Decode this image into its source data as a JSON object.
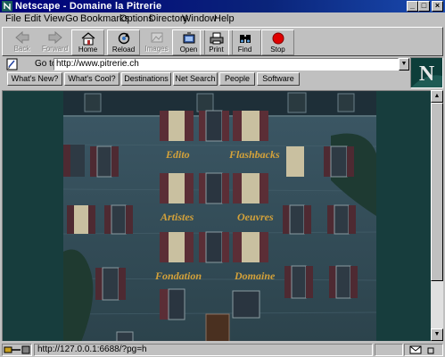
{
  "window": {
    "title": "Netscape - Domaine la Pitrerie"
  },
  "menu": [
    {
      "label": "File"
    },
    {
      "label": "Edit"
    },
    {
      "label": "View"
    },
    {
      "label": "Go"
    },
    {
      "label": "Bookmarks"
    },
    {
      "label": "Options"
    },
    {
      "label": "Directory"
    },
    {
      "label": "Window"
    },
    {
      "label": "Help"
    }
  ],
  "toolbar": {
    "back": "Back",
    "forward": "Forward",
    "home": "Home",
    "reload": "Reload",
    "images": "Images",
    "open": "Open",
    "print": "Print",
    "find": "Find",
    "stop": "Stop"
  },
  "location": {
    "label": "Go to:",
    "url": "http://www.pitrerie.ch"
  },
  "directory": [
    "What's New?",
    "What's Cool?",
    "Destinations",
    "Net Search",
    "People",
    "Software"
  ],
  "logo": {
    "letter": "N"
  },
  "page": {
    "links": [
      "Edito",
      "Flashbacks",
      "Artistes",
      "Oeuvres",
      "Fondation",
      "Domaine"
    ]
  },
  "status": {
    "text": "http://127.0.0.1:6688/?pg=h"
  },
  "colors": {
    "link": "#d4a23a",
    "background": "#173d3d",
    "title_bar": "#00007b"
  }
}
